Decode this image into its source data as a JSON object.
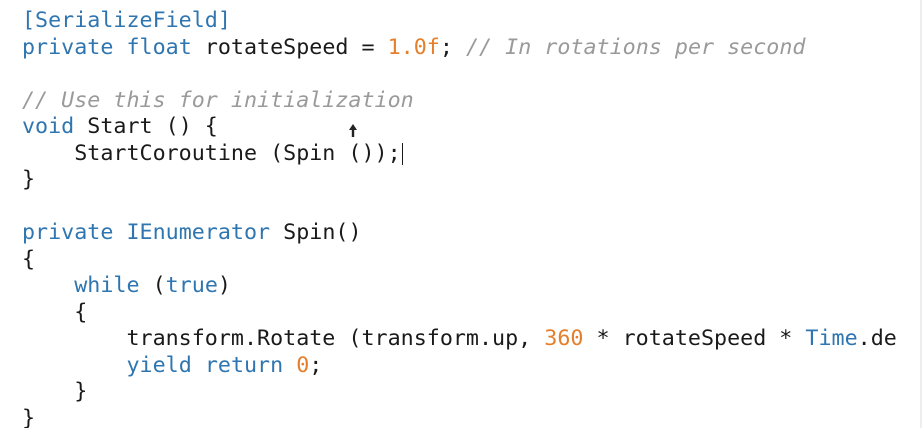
{
  "editor": {
    "language": "C#",
    "colors": {
      "keyword": "#2f76b0",
      "number": "#e57f2c",
      "comment": "#9a9a9a",
      "text": "#1a1a1a",
      "background": "#ffffff"
    },
    "lines": [
      {
        "tokens": [
          {
            "type": "attr",
            "text": "[SerializeField]"
          }
        ]
      },
      {
        "tokens": [
          {
            "type": "kw",
            "text": "private"
          },
          {
            "type": "plain",
            "text": " "
          },
          {
            "type": "kw",
            "text": "float"
          },
          {
            "type": "plain",
            "text": " rotateSpeed = "
          },
          {
            "type": "num",
            "text": "1.0f"
          },
          {
            "type": "plain",
            "text": "; "
          },
          {
            "type": "cm",
            "text": "// In rotations per second"
          }
        ]
      },
      {
        "tokens": []
      },
      {
        "tokens": [
          {
            "type": "cm",
            "text": "// Use this for initialization"
          }
        ]
      },
      {
        "tokens": [
          {
            "type": "kw",
            "text": "void"
          },
          {
            "type": "plain",
            "text": " Start () {"
          }
        ]
      },
      {
        "tokens": [
          {
            "type": "plain",
            "text": "    StartCoroutine (Spin ());"
          },
          {
            "type": "caret",
            "text": ""
          }
        ]
      },
      {
        "tokens": [
          {
            "type": "plain",
            "text": "}"
          }
        ]
      },
      {
        "tokens": []
      },
      {
        "tokens": [
          {
            "type": "kw",
            "text": "private"
          },
          {
            "type": "plain",
            "text": " "
          },
          {
            "type": "ty",
            "text": "IEnumerator"
          },
          {
            "type": "plain",
            "text": " Spin()"
          }
        ]
      },
      {
        "tokens": [
          {
            "type": "plain",
            "text": "{"
          }
        ]
      },
      {
        "tokens": [
          {
            "type": "plain",
            "text": "    "
          },
          {
            "type": "kw",
            "text": "while"
          },
          {
            "type": "plain",
            "text": " ("
          },
          {
            "type": "kw",
            "text": "true"
          },
          {
            "type": "plain",
            "text": ")"
          }
        ]
      },
      {
        "tokens": [
          {
            "type": "plain",
            "text": "    {"
          }
        ]
      },
      {
        "tokens": [
          {
            "type": "plain",
            "text": "        transform.Rotate (transform.up, "
          },
          {
            "type": "num",
            "text": "360"
          },
          {
            "type": "plain",
            "text": " * rotateSpeed * "
          },
          {
            "type": "ty",
            "text": "Time"
          },
          {
            "type": "plain",
            "text": ".de"
          }
        ]
      },
      {
        "tokens": [
          {
            "type": "plain",
            "text": "        "
          },
          {
            "type": "kw",
            "text": "yield"
          },
          {
            "type": "plain",
            "text": " "
          },
          {
            "type": "kw",
            "text": "return"
          },
          {
            "type": "plain",
            "text": " "
          },
          {
            "type": "num",
            "text": "0"
          },
          {
            "type": "plain",
            "text": ";"
          }
        ]
      },
      {
        "tokens": [
          {
            "type": "plain",
            "text": "    }"
          }
        ]
      },
      {
        "tokens": [
          {
            "type": "plain",
            "text": "}"
          }
        ]
      }
    ]
  }
}
